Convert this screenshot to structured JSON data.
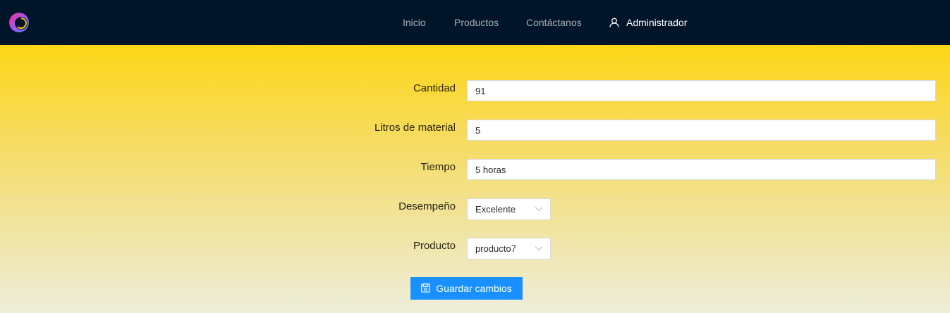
{
  "navbar": {
    "logo_icon": "swirl-logo-icon",
    "items": [
      {
        "label": "Inicio"
      },
      {
        "label": "Productos"
      },
      {
        "label": "Contáctanos"
      }
    ],
    "user": {
      "icon": "user-icon",
      "label": "Administrador"
    },
    "background_color": "#001529"
  },
  "form": {
    "cantidad": {
      "label": "Cantidad",
      "value": "91"
    },
    "litros": {
      "label": "Litros de material",
      "value": "5"
    },
    "tiempo": {
      "label": "Tiempo",
      "value": "5 horas"
    },
    "desempeno": {
      "label": "Desempeño",
      "selected": "Excelente"
    },
    "producto": {
      "label": "Producto",
      "selected": "producto7"
    },
    "save_button": {
      "label": "Guardar cambios",
      "icon": "save-icon",
      "color": "#1890ff"
    }
  }
}
